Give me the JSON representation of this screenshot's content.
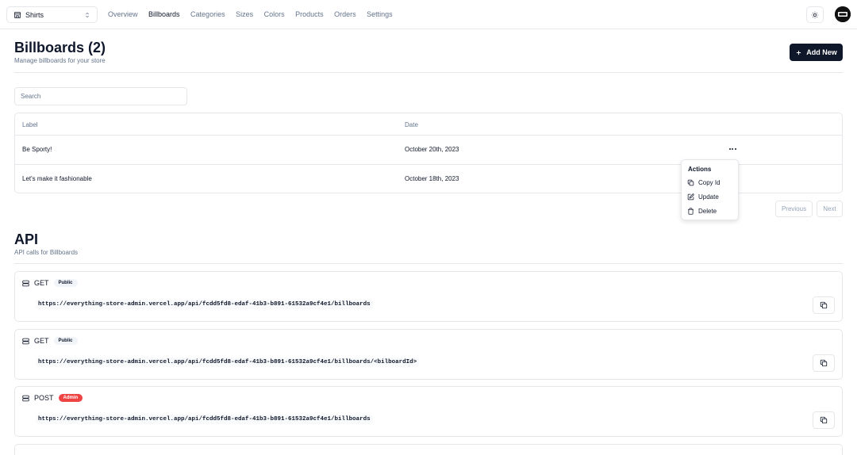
{
  "store": {
    "name": "Shirts"
  },
  "nav": {
    "items": [
      {
        "label": "Overview"
      },
      {
        "label": "Billboards"
      },
      {
        "label": "Categories"
      },
      {
        "label": "Sizes"
      },
      {
        "label": "Colors"
      },
      {
        "label": "Products"
      },
      {
        "label": "Orders"
      },
      {
        "label": "Settings"
      }
    ],
    "active": "Billboards"
  },
  "header": {
    "title": "Billboards (2)",
    "subtitle": "Manage billboards for your store",
    "add_label": "Add New"
  },
  "search": {
    "placeholder": "Search",
    "value": ""
  },
  "table": {
    "columns": [
      "Label",
      "Date"
    ],
    "rows": [
      {
        "label": "Be Sporty!",
        "date": "October 20th, 2023"
      },
      {
        "label": "Let's make it fashionable",
        "date": "October 18th, 2023"
      }
    ]
  },
  "pagination": {
    "previous": "Previous",
    "next": "Next"
  },
  "actions_menu": {
    "title": "Actions",
    "items": [
      {
        "label": "Copy Id",
        "icon": "copy-icon"
      },
      {
        "label": "Update",
        "icon": "edit-icon"
      },
      {
        "label": "Delete",
        "icon": "trash-icon"
      }
    ]
  },
  "api": {
    "title": "API",
    "subtitle": "API calls for Billboards",
    "routes": [
      {
        "method": "GET",
        "badge": "Public",
        "url": "https://everything-store-admin.vercel.app/api/fcdd5fd8-edaf-41b3-b891-61532a9cf4e1/billboards"
      },
      {
        "method": "GET",
        "badge": "Public",
        "url": "https://everything-store-admin.vercel.app/api/fcdd5fd8-edaf-41b3-b891-61532a9cf4e1/billboards/<bilboardId>"
      },
      {
        "method": "POST",
        "badge": "Admin",
        "url": "https://everything-store-admin.vercel.app/api/fcdd5fd8-edaf-41b3-b891-61532a9cf4e1/billboards"
      }
    ]
  },
  "colors": {
    "primary": "#0f172a",
    "muted": "#64748b",
    "border": "#e5e7eb",
    "admin_badge": "#ef4444"
  }
}
